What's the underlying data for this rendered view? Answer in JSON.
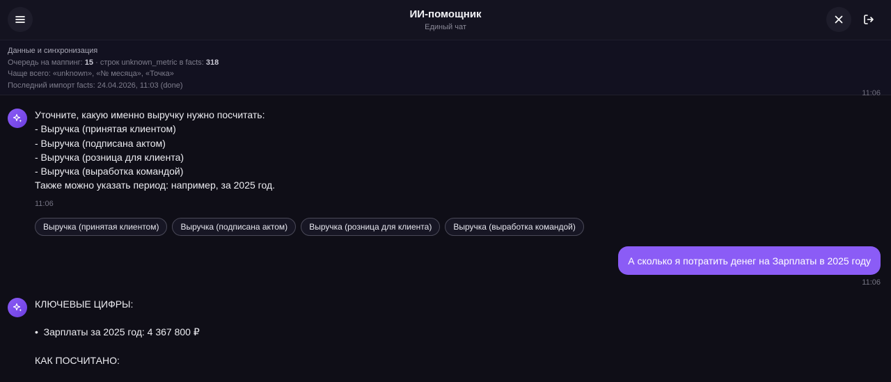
{
  "header": {
    "title": "ИИ-помощник",
    "subtitle": "Единый чат",
    "icons": {
      "menu": "menu-icon",
      "close": "close-icon",
      "logout": "logout-icon"
    }
  },
  "sync": {
    "title": "Данные и синхронизация",
    "queue_prefix": "Очередь на маппинг: ",
    "queue_count": "15",
    "queue_middle": " · строк unknown_metric в facts: ",
    "unknown_count": "318",
    "frequent": "Чаще всего: «unknown», «№ месяца», «Точка»",
    "last_import": "Последний импорт facts: 24.04.2026, 11:03 (done)"
  },
  "chat": {
    "cut_time": "11:06",
    "assistant_message_1": {
      "lines": [
        "Уточните, какую именно выручку нужно посчитать:",
        "- Выручка (принятая клиентом)",
        "- Выручка (подписана актом)",
        "- Выручка (розница для клиента)",
        "- Выручка (выработка командой)",
        "Также можно указать период: например, за 2025 год."
      ],
      "time": "11:06"
    },
    "suggestions": [
      "Выручка (принятая клиентом)",
      "Выручка (подписана актом)",
      "Выручка (розница для клиента)",
      "Выручка (выработка командой)"
    ],
    "user_message": {
      "text": "А сколько я потратить денег на Зарплаты в 2025 году",
      "time": "11:06"
    },
    "assistant_message_2": {
      "heading": "КЛЮЧЕВЫЕ ЦИФРЫ:",
      "bullet": "•  Зарплаты за 2025 год: 4 367 800 ₽",
      "how_heading": "КАК ПОСЧИТАНО:"
    }
  },
  "colors": {
    "background": "#0f0e17",
    "accent": "#8b5cf6",
    "chip_border": "#4a4958"
  }
}
